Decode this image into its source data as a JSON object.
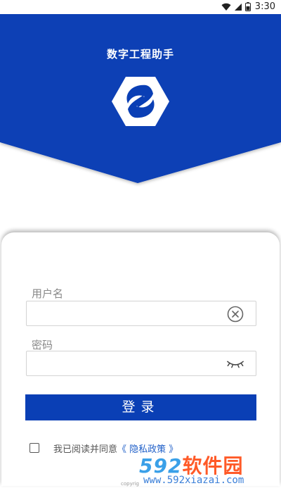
{
  "status_bar": {
    "time": "3:30",
    "icons": [
      "wifi-icon",
      "signal-icon",
      "battery-icon"
    ]
  },
  "app": {
    "title": "数字工程助手",
    "logo_icon": "app-logo-icon",
    "brand_color": "#0a3fb5"
  },
  "form": {
    "username_label": "用户名",
    "username_value": "",
    "username_icon": "clear-icon",
    "password_label": "密码",
    "password_value": "",
    "password_icon": "eye-closed-icon",
    "login_label": "登录"
  },
  "agreement": {
    "text": "我已阅读并同意",
    "link": "《 隐私政策 》",
    "checked": false
  },
  "footer": {
    "copyright": "copyrig"
  },
  "watermark": {
    "brand_number": "592",
    "brand_text": "软件园",
    "url": "www.592xiazai.com"
  }
}
